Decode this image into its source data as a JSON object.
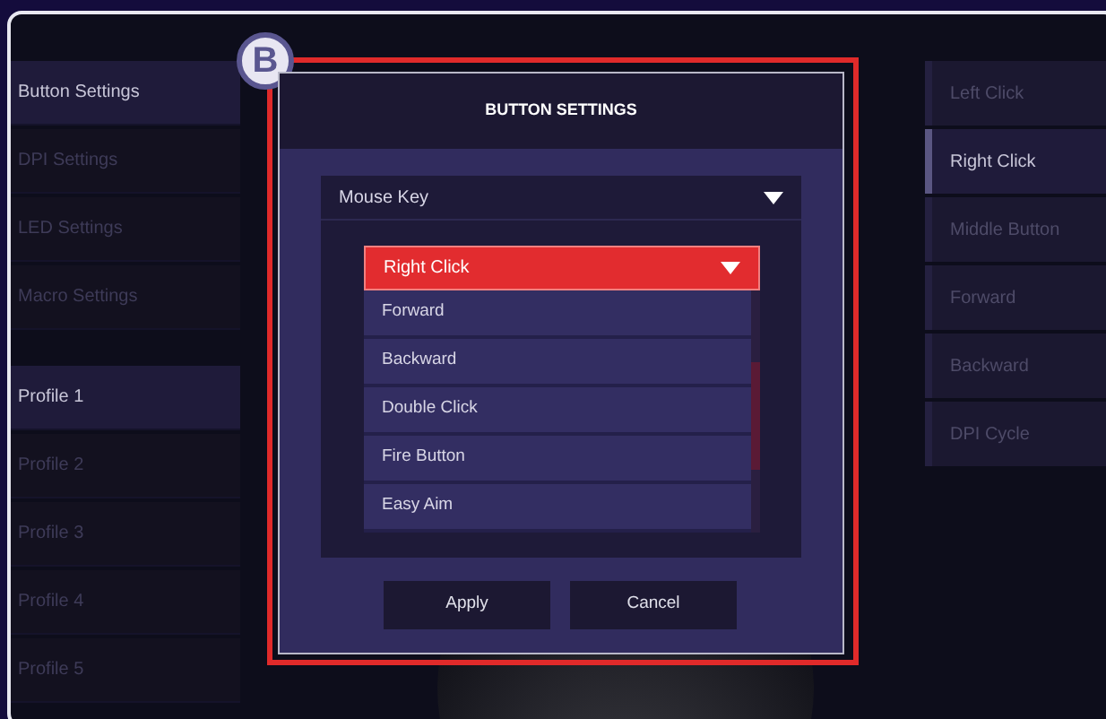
{
  "sidebar": {
    "settings": [
      {
        "label": "Button Settings",
        "selected": true
      },
      {
        "label": "DPI Settings",
        "selected": false
      },
      {
        "label": "LED Settings",
        "selected": false
      },
      {
        "label": "Macro Settings",
        "selected": false
      }
    ],
    "profiles": [
      {
        "label": "Profile 1",
        "selected": true
      },
      {
        "label": "Profile 2",
        "selected": false
      },
      {
        "label": "Profile 3",
        "selected": false
      },
      {
        "label": "Profile 4",
        "selected": false
      },
      {
        "label": "Profile 5",
        "selected": false
      }
    ]
  },
  "dialog": {
    "badge": "B",
    "title": "BUTTON SETTINGS",
    "section": {
      "label": "Mouse Key",
      "expanded": true
    },
    "dropdown": {
      "value": "Right Click",
      "expanded": true,
      "options": [
        "Forward",
        "Backward",
        "Double Click",
        "Fire Button",
        "Easy Aim"
      ]
    },
    "buttons": [
      "Apply",
      "Cancel"
    ]
  },
  "button_list": [
    {
      "label": "Left Click",
      "selected": false
    },
    {
      "label": "Right Click",
      "selected": true
    },
    {
      "label": "Middle Button",
      "selected": false
    },
    {
      "label": "Forward",
      "selected": false
    },
    {
      "label": "Backward",
      "selected": false
    },
    {
      "label": "DPI Cycle",
      "selected": false
    }
  ]
}
